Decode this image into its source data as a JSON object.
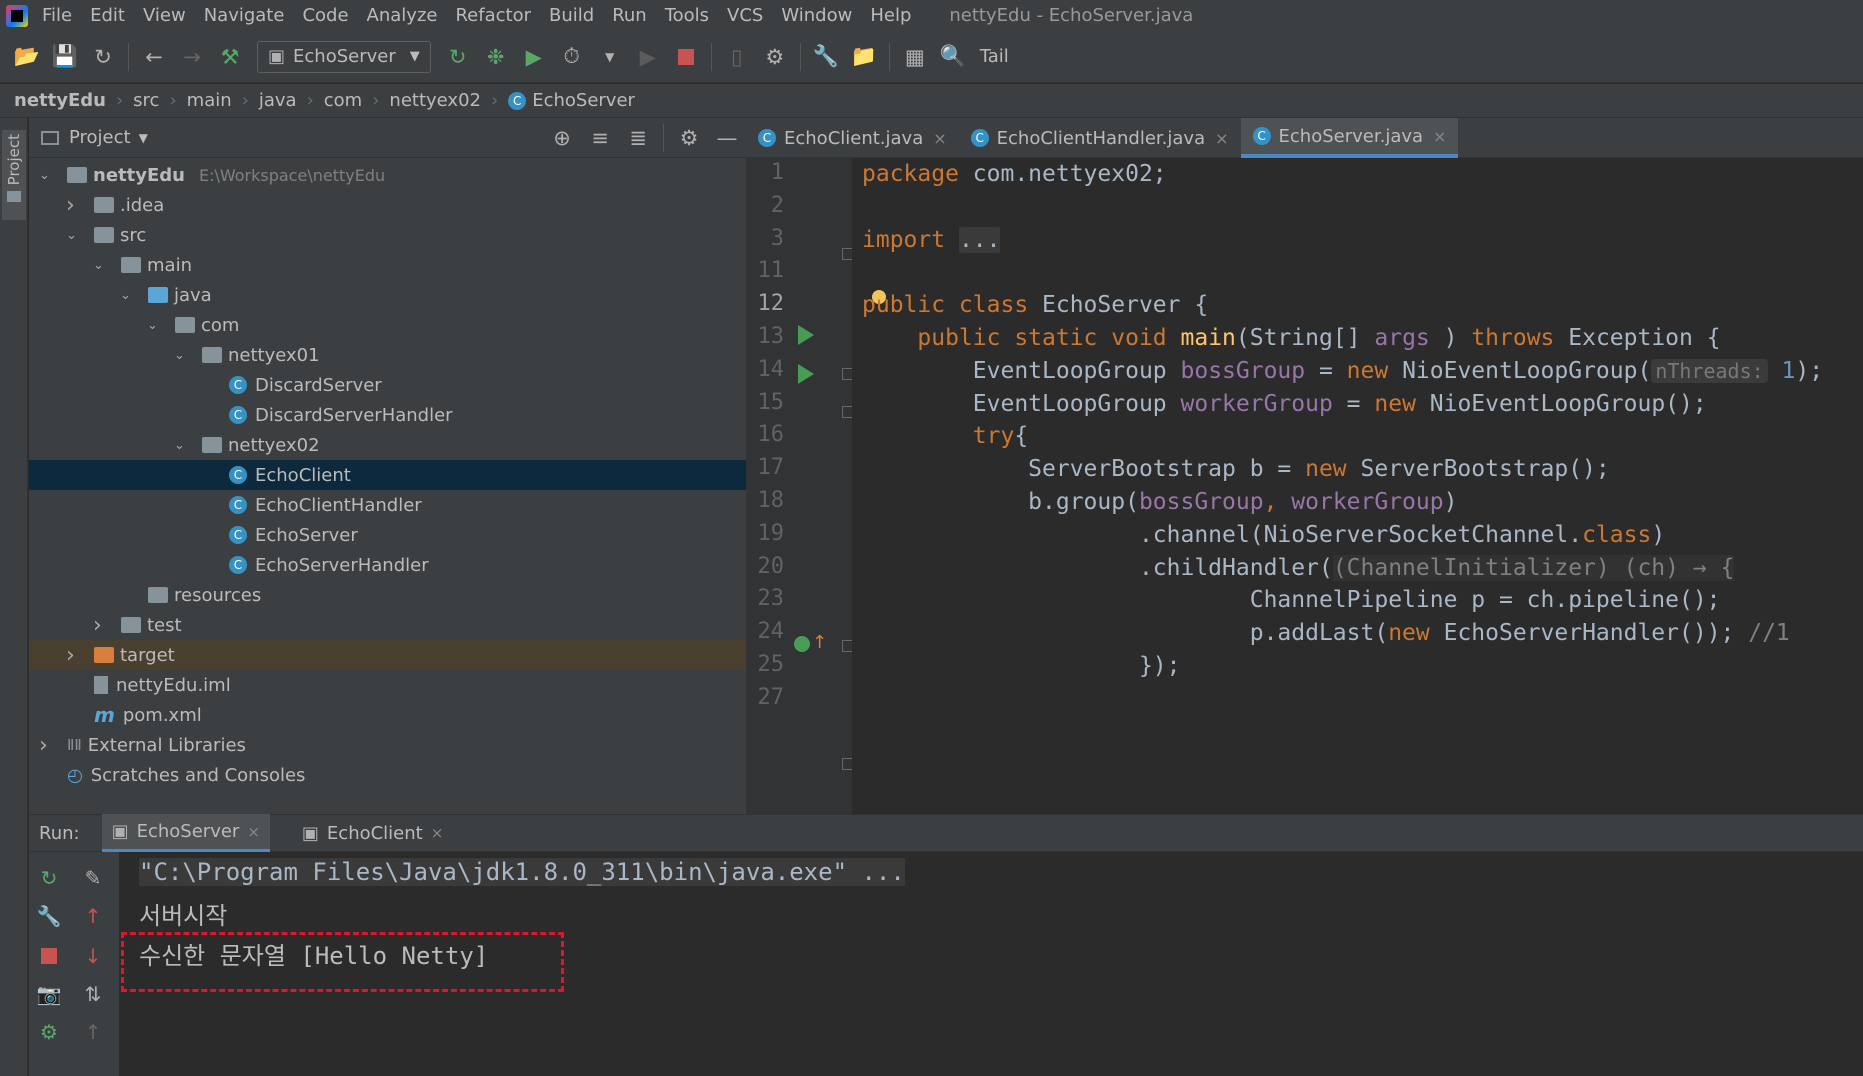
{
  "window": {
    "menu": [
      "File",
      "Edit",
      "View",
      "Navigate",
      "Code",
      "Analyze",
      "Refactor",
      "Build",
      "Run",
      "Tools",
      "VCS",
      "Window",
      "Help"
    ],
    "title": "nettyEdu - EchoServer.java"
  },
  "toolbar": {
    "run_config": "EchoServer",
    "tail_label": "Tail"
  },
  "breadcrumb": [
    "nettyEdu",
    "src",
    "main",
    "java",
    "com",
    "nettyex02",
    "EchoServer"
  ],
  "left_stripe": {
    "label": "Project"
  },
  "project_panel": {
    "title": "Project",
    "tree": [
      {
        "label": "nettyEdu",
        "extra": "E:\\Workspace\\nettyEdu",
        "depth": 0,
        "arrow": "down",
        "icon": "module-icon"
      },
      {
        "label": ".idea",
        "depth": 1,
        "arrow": "right",
        "icon": "folder-icon"
      },
      {
        "label": "src",
        "depth": 1,
        "arrow": "down",
        "icon": "folder-icon"
      },
      {
        "label": "main",
        "depth": 2,
        "arrow": "down",
        "icon": "folder-icon"
      },
      {
        "label": "java",
        "depth": 3,
        "arrow": "down",
        "icon": "source-folder-icon"
      },
      {
        "label": "com",
        "depth": 4,
        "arrow": "down",
        "icon": "package-icon"
      },
      {
        "label": "nettyex01",
        "depth": 5,
        "arrow": "down",
        "icon": "package-icon"
      },
      {
        "label": "DiscardServer",
        "depth": 6,
        "arrow": "",
        "icon": "class-icon"
      },
      {
        "label": "DiscardServerHandler",
        "depth": 6,
        "arrow": "",
        "icon": "class-icon"
      },
      {
        "label": "nettyex02",
        "depth": 5,
        "arrow": "down",
        "icon": "package-icon"
      },
      {
        "label": "EchoClient",
        "depth": 6,
        "arrow": "",
        "icon": "class-icon",
        "selected": true
      },
      {
        "label": "EchoClientHandler",
        "depth": 6,
        "arrow": "",
        "icon": "class-icon"
      },
      {
        "label": "EchoServer",
        "depth": 6,
        "arrow": "",
        "icon": "class-icon"
      },
      {
        "label": "EchoServerHandler",
        "depth": 6,
        "arrow": "",
        "icon": "class-icon"
      },
      {
        "label": "resources",
        "depth": 3,
        "arrow": "",
        "icon": "resources-folder-icon"
      },
      {
        "label": "test",
        "depth": 2,
        "arrow": "right",
        "icon": "folder-icon"
      },
      {
        "label": "target",
        "depth": 1,
        "arrow": "right",
        "icon": "excluded-folder-icon",
        "excluded": true
      },
      {
        "label": "nettyEdu.iml",
        "depth": 1,
        "arrow": "",
        "icon": "iml-file-icon"
      },
      {
        "label": "pom.xml",
        "depth": 1,
        "arrow": "",
        "icon": "maven-icon"
      },
      {
        "label": "External Libraries",
        "depth": 0,
        "arrow": "right",
        "icon": "libraries-icon"
      },
      {
        "label": "Scratches and Consoles",
        "depth": 0,
        "arrow": "",
        "icon": "scratches-icon"
      }
    ]
  },
  "editor_tabs": [
    {
      "label": "EchoClient.java",
      "active": false
    },
    {
      "label": "EchoClientHandler.java",
      "active": false
    },
    {
      "label": "EchoServer.java",
      "active": true
    }
  ],
  "code": {
    "line_numbers": [
      "1",
      "2",
      "3",
      "11",
      "12",
      "13",
      "14",
      "15",
      "16",
      "17",
      "18",
      "19",
      "20",
      "23",
      "24",
      "25",
      "27"
    ],
    "lines": [
      [
        [
          "kw",
          "package "
        ],
        [
          "",
          "com.nettyex02;"
        ]
      ],
      [],
      [
        [
          "kw",
          "import "
        ],
        [
          "fold",
          "..."
        ]
      ],
      [],
      [
        [
          "kw",
          "public class "
        ],
        [
          "",
          "EchoServer {"
        ]
      ],
      [
        [
          "",
          "    "
        ],
        [
          "kw",
          "public static void "
        ],
        [
          "fn",
          "main"
        ],
        [
          "",
          "(String[] "
        ],
        [
          "fld",
          "args"
        ],
        [
          "",
          " ) "
        ],
        [
          "kw",
          "throws "
        ],
        [
          "",
          "Exception {"
        ]
      ],
      [
        [
          "",
          "        EventLoopGroup "
        ],
        [
          "fld",
          "bossGroup"
        ],
        [
          "",
          " = "
        ],
        [
          "kw",
          "new "
        ],
        [
          "",
          "NioEventLoopGroup("
        ],
        [
          "hint",
          "nThreads:"
        ],
        [
          "num",
          " 1"
        ],
        [
          "",
          ");"
        ]
      ],
      [
        [
          "",
          "        EventLoopGroup "
        ],
        [
          "fld",
          "workerGroup"
        ],
        [
          "",
          " = "
        ],
        [
          "kw",
          "new "
        ],
        [
          "",
          "NioEventLoopGroup();"
        ]
      ],
      [
        [
          "",
          "        "
        ],
        [
          "kw",
          "try"
        ],
        [
          "",
          "{"
        ]
      ],
      [
        [
          "",
          "            ServerBootstrap b = "
        ],
        [
          "kw",
          "new "
        ],
        [
          "",
          "ServerBootstrap();"
        ]
      ],
      [
        [
          "",
          "            b.group("
        ],
        [
          "fld",
          "bossGroup"
        ],
        [
          "kw",
          ", "
        ],
        [
          "fld",
          "workerGroup"
        ],
        [
          "",
          ")"
        ]
      ],
      [
        [
          "",
          "                    .channel(NioServerSocketChannel."
        ],
        [
          "kw",
          "class"
        ],
        [
          "",
          ")"
        ]
      ],
      [
        [
          "",
          "                    .childHandler("
        ],
        [
          "lambda",
          "(ChannelInitializer) (ch) → {"
        ]
      ],
      [
        [
          "",
          "                            ChannelPipeline p = ch.pipeline();"
        ]
      ],
      [
        [
          "",
          "                            p.addLast("
        ],
        [
          "kw",
          "new "
        ],
        [
          "",
          "EchoServerHandler()); "
        ],
        [
          "cm",
          "//1"
        ]
      ],
      [
        [
          "",
          "                    });"
        ]
      ],
      []
    ]
  },
  "run_panel": {
    "label": "Run:",
    "tabs": [
      {
        "label": "EchoServer",
        "active": true
      },
      {
        "label": "EchoClient",
        "active": false
      }
    ],
    "console": [
      "\"C:\\Program Files\\Java\\jdk1.8.0_311\\bin\\java.exe\" ...",
      "서버시작",
      "수신한 문자열 [Hello Netty]"
    ]
  },
  "colors": {
    "accent": "#4a88c7",
    "highlight_border": "#e0142c",
    "selection": "#0d293e"
  }
}
